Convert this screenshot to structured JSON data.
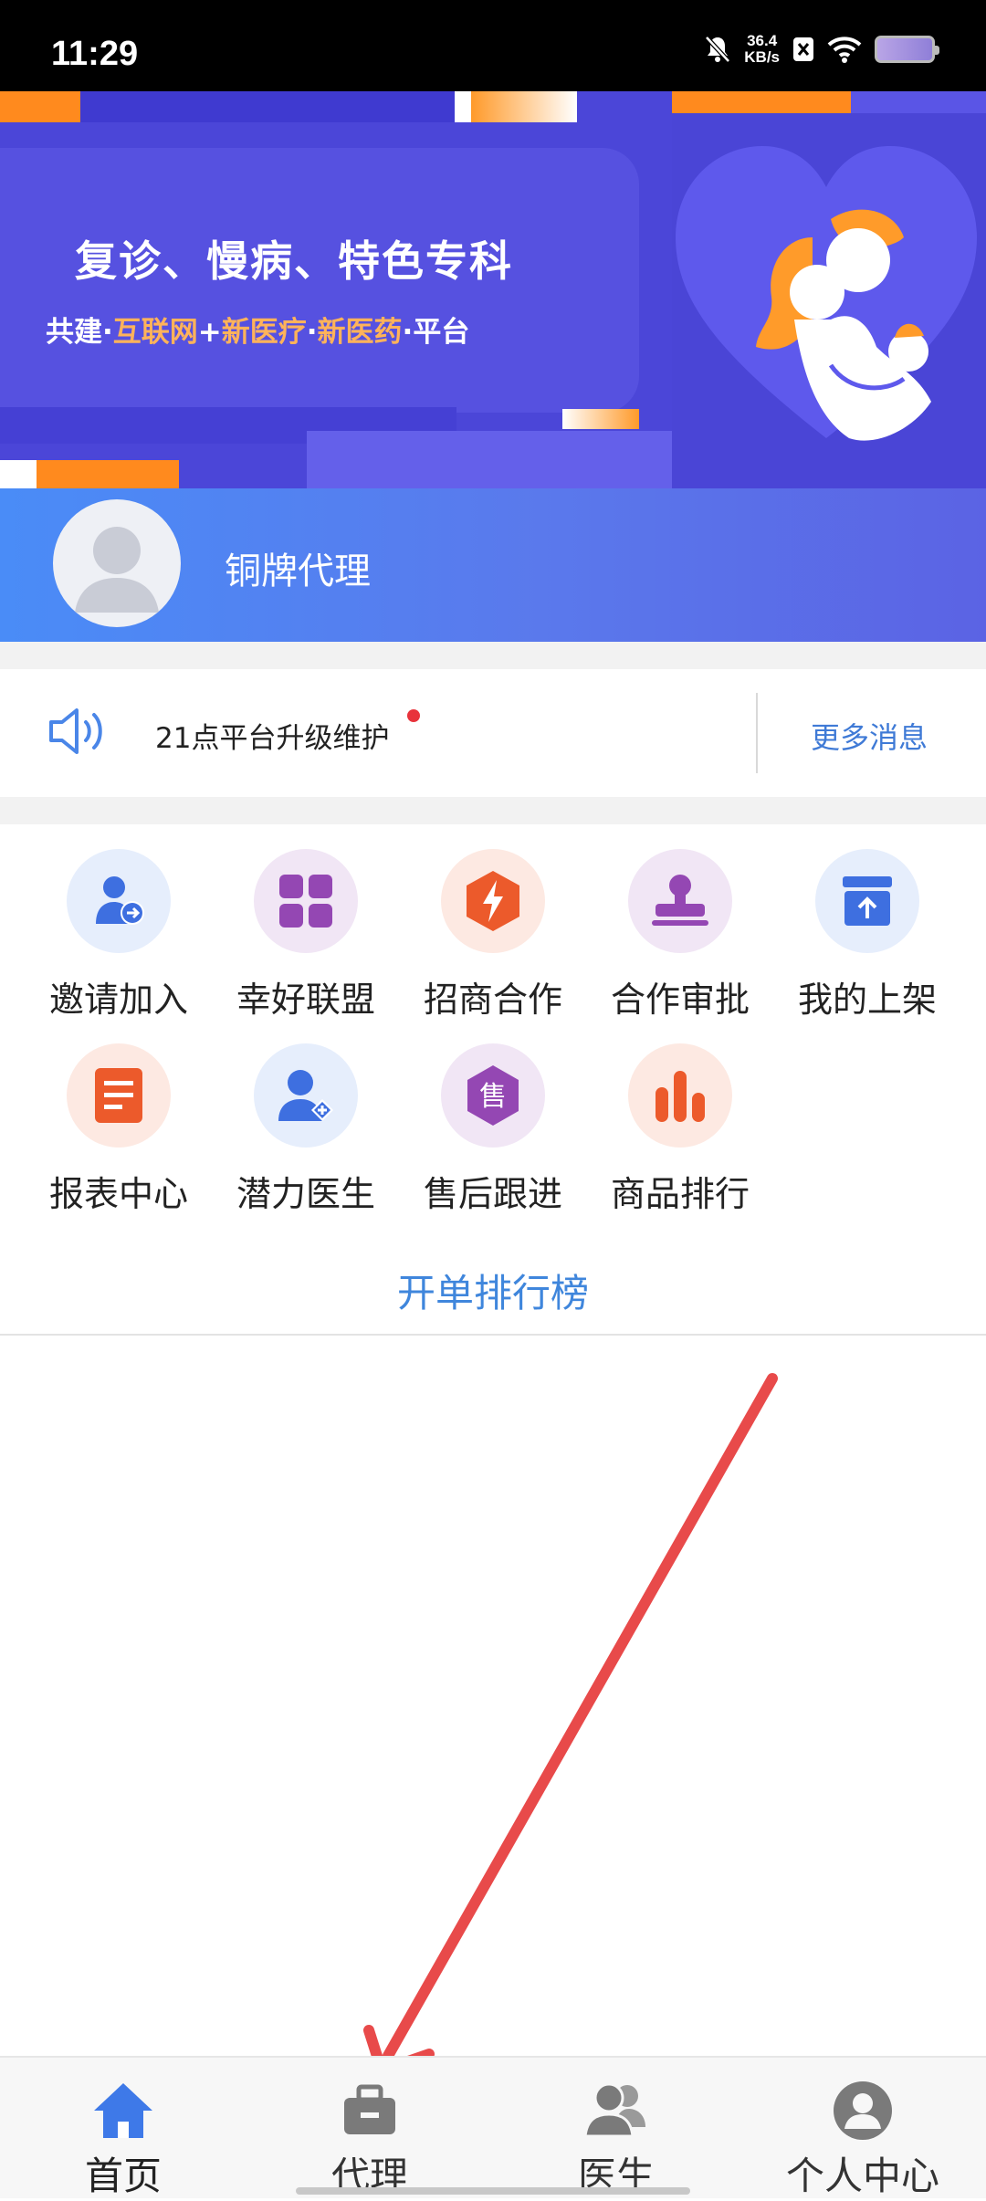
{
  "status": {
    "time": "11:29",
    "speed_value": "36.4",
    "speed_unit": "KB/s"
  },
  "banner": {
    "title": "复诊、慢病、特色专科",
    "sub_part1": "共建·",
    "sub_hl1": "互联网",
    "sub_part2": "+",
    "sub_hl2": "新医疗",
    "sub_part3": "·",
    "sub_hl3": "新医药",
    "sub_part4": "·平台"
  },
  "agent": {
    "name": "铜牌代理"
  },
  "notice": {
    "text": "21点平台升级维护",
    "more": "更多消息"
  },
  "grid": {
    "items": [
      {
        "label": "邀请加入",
        "icon": "user-invite-icon"
      },
      {
        "label": "幸好联盟",
        "icon": "grid-apps-icon"
      },
      {
        "label": "招商合作",
        "icon": "lightning-icon"
      },
      {
        "label": "合作审批",
        "icon": "stamp-icon"
      },
      {
        "label": "我的上架",
        "icon": "shelf-upload-icon"
      },
      {
        "label": "报表中心",
        "icon": "report-icon"
      },
      {
        "label": "潜力医生",
        "icon": "user-add-icon"
      },
      {
        "label": "售后跟进",
        "icon": "after-sale-icon"
      },
      {
        "label": "商品排行",
        "icon": "bar-chart-icon"
      }
    ],
    "ranking": "开单排行榜"
  },
  "tabs": [
    {
      "label": "首页",
      "icon": "home-icon",
      "active": true
    },
    {
      "label": "代理",
      "icon": "briefcase-icon"
    },
    {
      "label": "医生",
      "icon": "doctors-icon"
    },
    {
      "label": "个人中心",
      "icon": "profile-icon"
    }
  ],
  "colors": {
    "brand_blue": "#4b46d8",
    "link_blue": "#3f7ad6",
    "accent_orange": "#ffb35a",
    "annotation_red": "#e84a4a"
  }
}
